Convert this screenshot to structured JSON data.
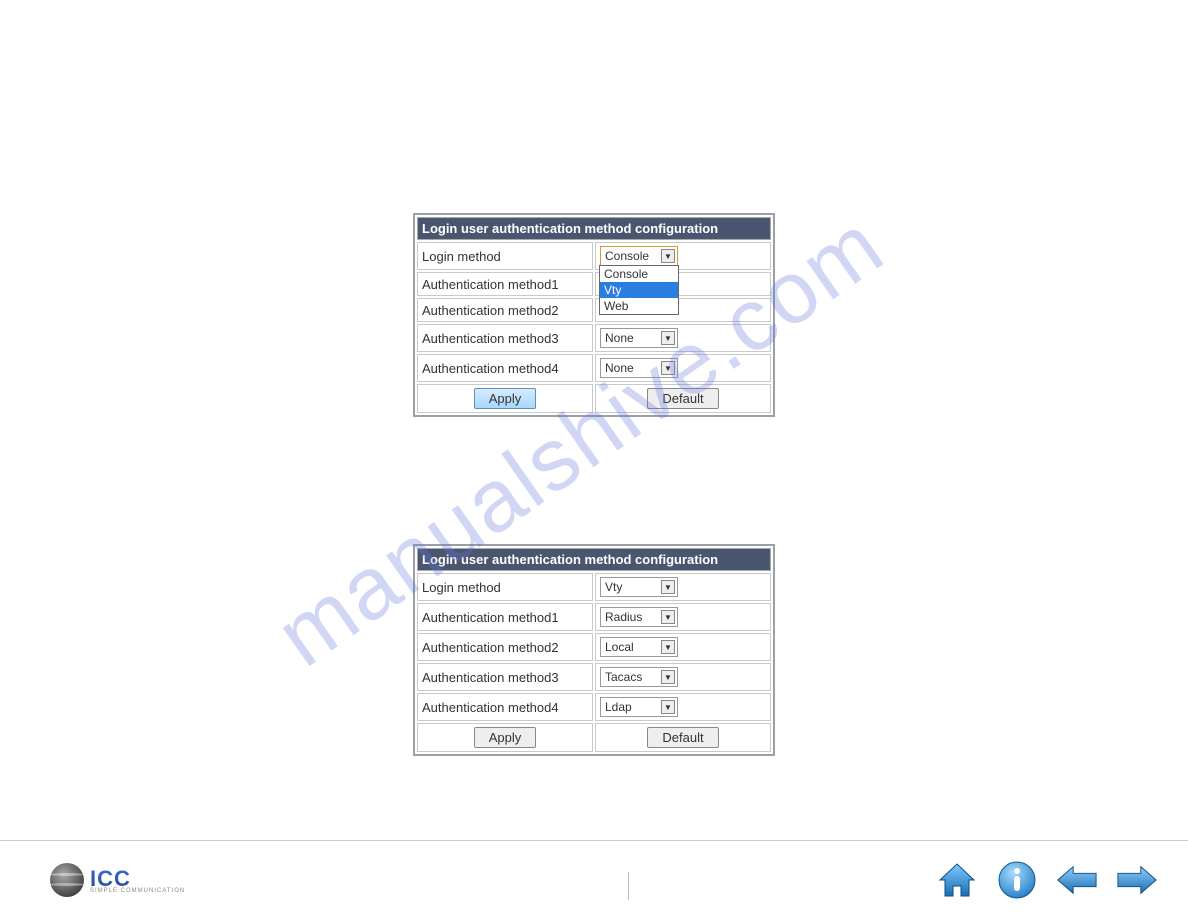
{
  "watermark": "manualshive.com",
  "table1": {
    "title": "Login user authentication method configuration",
    "rows": [
      {
        "label": "Login method",
        "value": "Console"
      },
      {
        "label": "Authentication method1",
        "value": ""
      },
      {
        "label": "Authentication method2",
        "value": ""
      },
      {
        "label": "Authentication method3",
        "value": "None"
      },
      {
        "label": "Authentication method4",
        "value": "None"
      }
    ],
    "dropdown_options": [
      "Console",
      "Vty",
      "Web"
    ],
    "dropdown_selected": "Vty",
    "apply": "Apply",
    "default": "Default"
  },
  "table2": {
    "title": "Login user authentication method configuration",
    "rows": [
      {
        "label": "Login method",
        "value": "Vty"
      },
      {
        "label": "Authentication method1",
        "value": "Radius"
      },
      {
        "label": "Authentication method2",
        "value": "Local"
      },
      {
        "label": "Authentication method3",
        "value": "Tacacs"
      },
      {
        "label": "Authentication method4",
        "value": "Ldap"
      }
    ],
    "apply": "Apply",
    "default": "Default"
  },
  "logo": {
    "text": "ICC",
    "sub": "SIMPLE COMMUNICATION"
  }
}
